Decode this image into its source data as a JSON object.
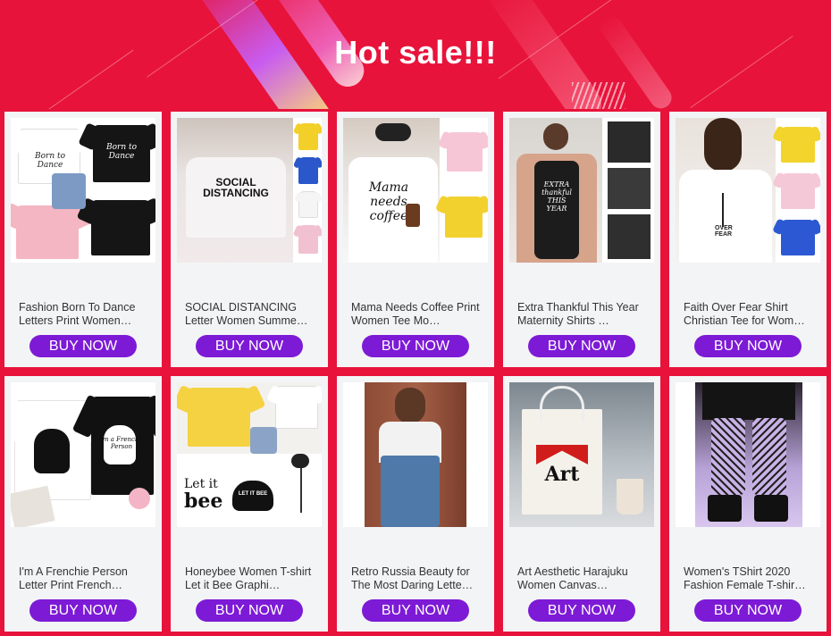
{
  "banner": {
    "title": "Hot sale!!!"
  },
  "products": [
    {
      "title": "Fashion Born To Dance Letters Print Women…",
      "button": "BUY NOW",
      "image_text_a": "Born to Dance",
      "image_text_b": "Born to Dance"
    },
    {
      "title": "SOCIAL DISTANCING Letter Women Summe…",
      "button": "BUY NOW",
      "image_text": "SOCIAL DISTANCING"
    },
    {
      "title": "Mama Needs Coffee Print Women Tee Mo…",
      "button": "BUY NOW",
      "image_text": "Mama needs coffee"
    },
    {
      "title": "Extra Thankful This Year Maternity Shirts …",
      "button": "BUY NOW",
      "image_text": "EXTRA thankful THIS YEAR"
    },
    {
      "title": "Faith Over Fear Shirt Christian Tee for Wom…",
      "button": "BUY NOW",
      "image_text": "OVER FEAR"
    },
    {
      "title": "I'm A Frenchie Person Letter Print French…",
      "button": "BUY NOW",
      "image_text": "I'm a Frenchie Person"
    },
    {
      "title": "Honeybee Women T-shirt Let it Bee Graphi…",
      "button": "BUY NOW",
      "image_text_a": "Let it",
      "image_text_b": "bee",
      "image_text_c": "LET IT BEE"
    },
    {
      "title": "Retro Russia Beauty for The Most Daring Lette…",
      "button": "BUY NOW"
    },
    {
      "title": "Art Aesthetic Harajuku Women Canvas…",
      "button": "BUY NOW",
      "image_text": "Art"
    },
    {
      "title": "Women's TShirt 2020 Fashion Female T-shir…",
      "button": "BUY NOW"
    }
  ],
  "colors": {
    "background": "#e8133b",
    "button": "#7d1ad6",
    "card": "#f3f4f6"
  }
}
